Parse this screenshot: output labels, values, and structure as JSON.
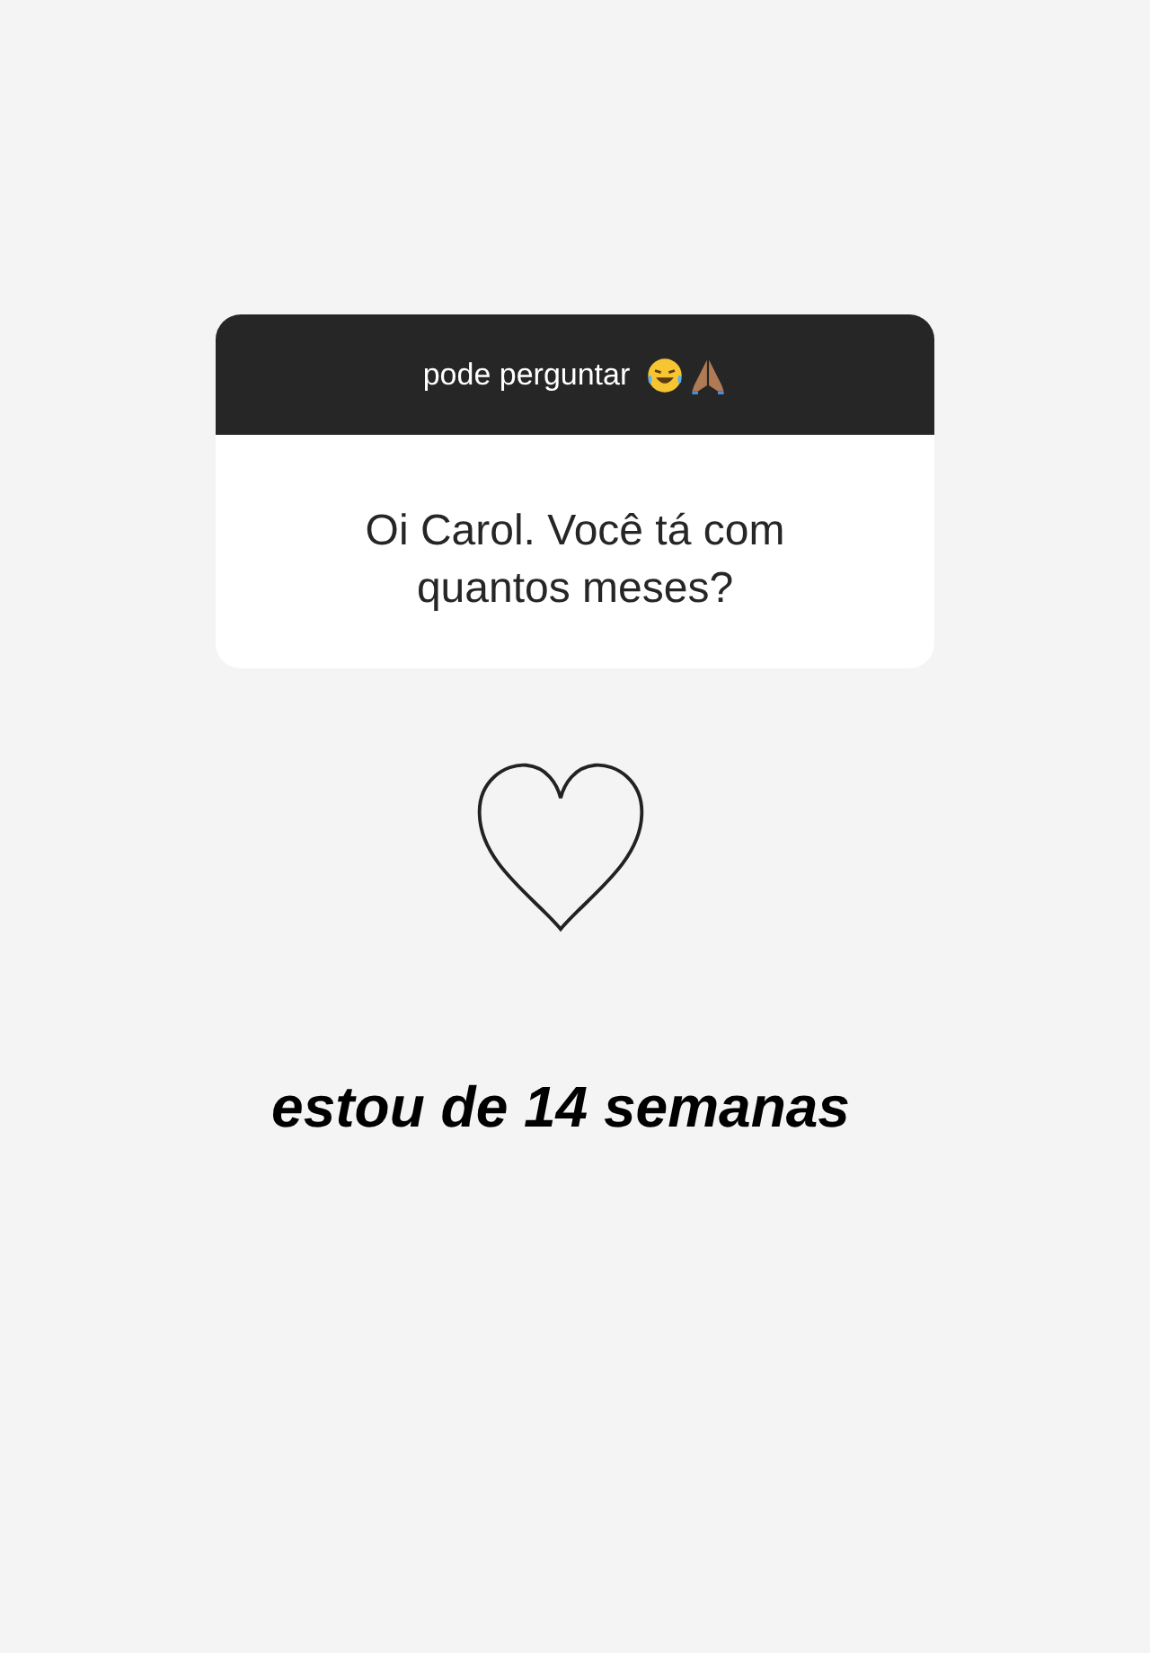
{
  "question_card": {
    "prompt": "pode perguntar",
    "question": "Oi Carol. Você tá com quantos meses?"
  },
  "answer": "estou de 14 semanas"
}
